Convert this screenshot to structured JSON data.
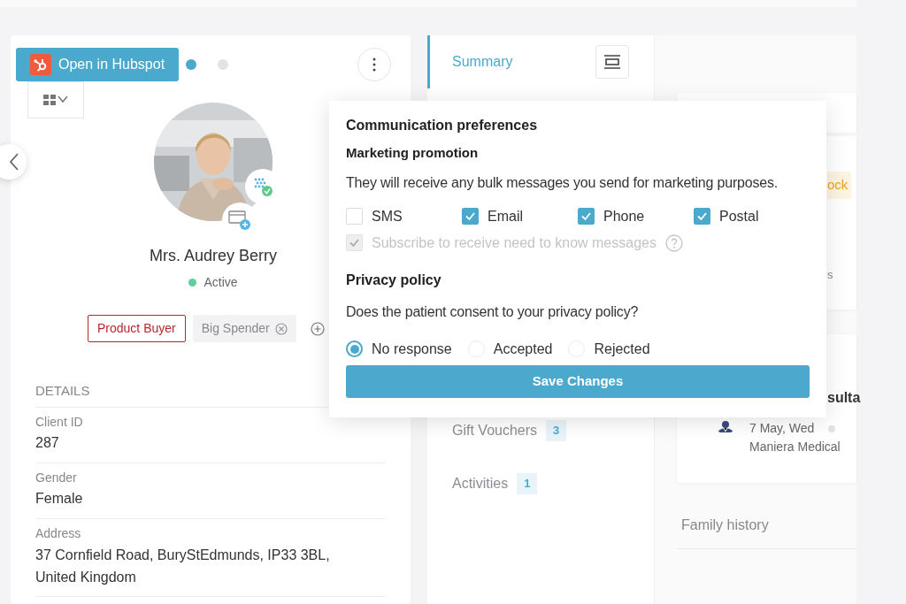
{
  "hubspot_button": {
    "label": "Open in Hubspot"
  },
  "pager_dots": [
    {
      "selected": true
    },
    {
      "selected": false
    }
  ],
  "profile": {
    "name": "Mrs. Audrey Berry",
    "status": "Active",
    "tags": [
      {
        "label": "Product Buyer",
        "kind": "outlined",
        "removable": false
      },
      {
        "label": "Big Spender",
        "kind": "filled",
        "removable": true
      }
    ]
  },
  "details": {
    "heading": "DETAILS",
    "fields": [
      {
        "label": "Client ID",
        "value": "287"
      },
      {
        "label": "Gender",
        "value": "Female"
      },
      {
        "label": "Address",
        "value": "37 Cornfield Road, BuryStEdmunds, IP33 3BL, United Kingdom"
      }
    ]
  },
  "nav": [
    {
      "label": "Summary",
      "selected": true
    },
    {
      "label": "Gift Vouchers",
      "count": "3",
      "selected": false
    },
    {
      "label": "Activities",
      "count": "1",
      "selected": false
    }
  ],
  "right_panel": {
    "badge_fragment": "ock",
    "text_fragment": "s",
    "appointment": {
      "title_fragment": "sulta",
      "date": "7 May, Wed",
      "location": "Maniera Medical"
    },
    "family_history": "Family history"
  },
  "popup": {
    "title": "Communication preferences",
    "section": "Marketing promotion",
    "description": "They will receive any bulk messages you send for marketing purposes.",
    "channels": [
      {
        "label": "SMS",
        "checked": false
      },
      {
        "label": "Email",
        "checked": true
      },
      {
        "label": "Phone",
        "checked": true
      },
      {
        "label": "Postal",
        "checked": true
      }
    ],
    "subscribe": {
      "label": "Subscribe to receive need to know messages",
      "checked": true,
      "disabled": true
    },
    "privacy_heading": "Privacy policy",
    "question": "Does the patient consent to your privacy policy?",
    "options": [
      {
        "label": "No response",
        "selected": true
      },
      {
        "label": "Accepted",
        "selected": false
      },
      {
        "label": "Rejected",
        "selected": false
      }
    ],
    "save_button": "Save Changes"
  }
}
